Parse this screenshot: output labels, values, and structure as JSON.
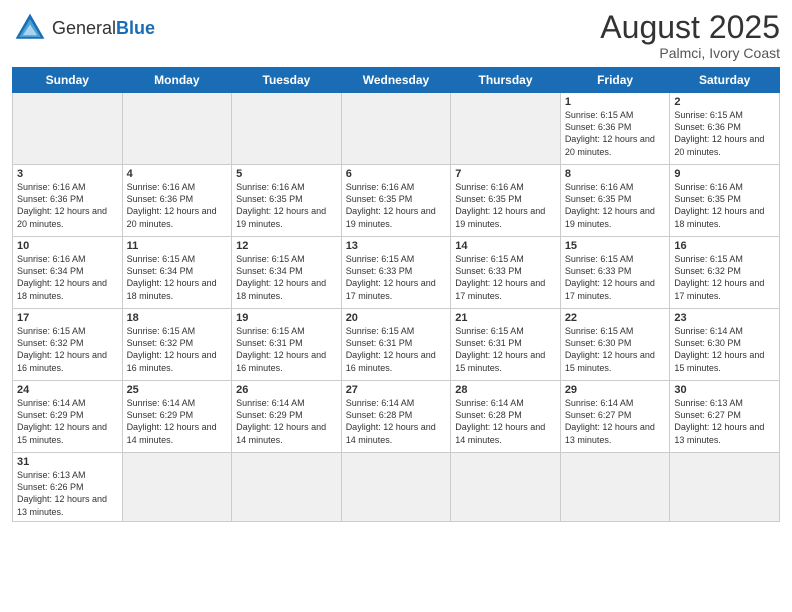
{
  "header": {
    "logo_general": "General",
    "logo_blue": "Blue",
    "month_year": "August 2025",
    "location": "Palmci, Ivory Coast"
  },
  "days_of_week": [
    "Sunday",
    "Monday",
    "Tuesday",
    "Wednesday",
    "Thursday",
    "Friday",
    "Saturday"
  ],
  "weeks": [
    [
      {
        "day": "",
        "info": "",
        "empty": true
      },
      {
        "day": "",
        "info": "",
        "empty": true
      },
      {
        "day": "",
        "info": "",
        "empty": true
      },
      {
        "day": "",
        "info": "",
        "empty": true
      },
      {
        "day": "",
        "info": "",
        "empty": true
      },
      {
        "day": "1",
        "info": "Sunrise: 6:15 AM\nSunset: 6:36 PM\nDaylight: 12 hours\nand 20 minutes."
      },
      {
        "day": "2",
        "info": "Sunrise: 6:15 AM\nSunset: 6:36 PM\nDaylight: 12 hours\nand 20 minutes."
      }
    ],
    [
      {
        "day": "3",
        "info": "Sunrise: 6:16 AM\nSunset: 6:36 PM\nDaylight: 12 hours\nand 20 minutes."
      },
      {
        "day": "4",
        "info": "Sunrise: 6:16 AM\nSunset: 6:36 PM\nDaylight: 12 hours\nand 20 minutes."
      },
      {
        "day": "5",
        "info": "Sunrise: 6:16 AM\nSunset: 6:35 PM\nDaylight: 12 hours\nand 19 minutes."
      },
      {
        "day": "6",
        "info": "Sunrise: 6:16 AM\nSunset: 6:35 PM\nDaylight: 12 hours\nand 19 minutes."
      },
      {
        "day": "7",
        "info": "Sunrise: 6:16 AM\nSunset: 6:35 PM\nDaylight: 12 hours\nand 19 minutes."
      },
      {
        "day": "8",
        "info": "Sunrise: 6:16 AM\nSunset: 6:35 PM\nDaylight: 12 hours\nand 19 minutes."
      },
      {
        "day": "9",
        "info": "Sunrise: 6:16 AM\nSunset: 6:35 PM\nDaylight: 12 hours\nand 18 minutes."
      }
    ],
    [
      {
        "day": "10",
        "info": "Sunrise: 6:16 AM\nSunset: 6:34 PM\nDaylight: 12 hours\nand 18 minutes."
      },
      {
        "day": "11",
        "info": "Sunrise: 6:15 AM\nSunset: 6:34 PM\nDaylight: 12 hours\nand 18 minutes."
      },
      {
        "day": "12",
        "info": "Sunrise: 6:15 AM\nSunset: 6:34 PM\nDaylight: 12 hours\nand 18 minutes."
      },
      {
        "day": "13",
        "info": "Sunrise: 6:15 AM\nSunset: 6:33 PM\nDaylight: 12 hours\nand 17 minutes."
      },
      {
        "day": "14",
        "info": "Sunrise: 6:15 AM\nSunset: 6:33 PM\nDaylight: 12 hours\nand 17 minutes."
      },
      {
        "day": "15",
        "info": "Sunrise: 6:15 AM\nSunset: 6:33 PM\nDaylight: 12 hours\nand 17 minutes."
      },
      {
        "day": "16",
        "info": "Sunrise: 6:15 AM\nSunset: 6:32 PM\nDaylight: 12 hours\nand 17 minutes."
      }
    ],
    [
      {
        "day": "17",
        "info": "Sunrise: 6:15 AM\nSunset: 6:32 PM\nDaylight: 12 hours\nand 16 minutes."
      },
      {
        "day": "18",
        "info": "Sunrise: 6:15 AM\nSunset: 6:32 PM\nDaylight: 12 hours\nand 16 minutes."
      },
      {
        "day": "19",
        "info": "Sunrise: 6:15 AM\nSunset: 6:31 PM\nDaylight: 12 hours\nand 16 minutes."
      },
      {
        "day": "20",
        "info": "Sunrise: 6:15 AM\nSunset: 6:31 PM\nDaylight: 12 hours\nand 16 minutes."
      },
      {
        "day": "21",
        "info": "Sunrise: 6:15 AM\nSunset: 6:31 PM\nDaylight: 12 hours\nand 15 minutes."
      },
      {
        "day": "22",
        "info": "Sunrise: 6:15 AM\nSunset: 6:30 PM\nDaylight: 12 hours\nand 15 minutes."
      },
      {
        "day": "23",
        "info": "Sunrise: 6:14 AM\nSunset: 6:30 PM\nDaylight: 12 hours\nand 15 minutes."
      }
    ],
    [
      {
        "day": "24",
        "info": "Sunrise: 6:14 AM\nSunset: 6:29 PM\nDaylight: 12 hours\nand 15 minutes."
      },
      {
        "day": "25",
        "info": "Sunrise: 6:14 AM\nSunset: 6:29 PM\nDaylight: 12 hours\nand 14 minutes."
      },
      {
        "day": "26",
        "info": "Sunrise: 6:14 AM\nSunset: 6:29 PM\nDaylight: 12 hours\nand 14 minutes."
      },
      {
        "day": "27",
        "info": "Sunrise: 6:14 AM\nSunset: 6:28 PM\nDaylight: 12 hours\nand 14 minutes."
      },
      {
        "day": "28",
        "info": "Sunrise: 6:14 AM\nSunset: 6:28 PM\nDaylight: 12 hours\nand 14 minutes."
      },
      {
        "day": "29",
        "info": "Sunrise: 6:14 AM\nSunset: 6:27 PM\nDaylight: 12 hours\nand 13 minutes."
      },
      {
        "day": "30",
        "info": "Sunrise: 6:13 AM\nSunset: 6:27 PM\nDaylight: 12 hours\nand 13 minutes."
      }
    ],
    [
      {
        "day": "31",
        "info": "Sunrise: 6:13 AM\nSunset: 6:26 PM\nDaylight: 12 hours\nand 13 minutes."
      },
      {
        "day": "",
        "info": "",
        "empty": true
      },
      {
        "day": "",
        "info": "",
        "empty": true
      },
      {
        "day": "",
        "info": "",
        "empty": true
      },
      {
        "day": "",
        "info": "",
        "empty": true
      },
      {
        "day": "",
        "info": "",
        "empty": true
      },
      {
        "day": "",
        "info": "",
        "empty": true
      }
    ]
  ]
}
